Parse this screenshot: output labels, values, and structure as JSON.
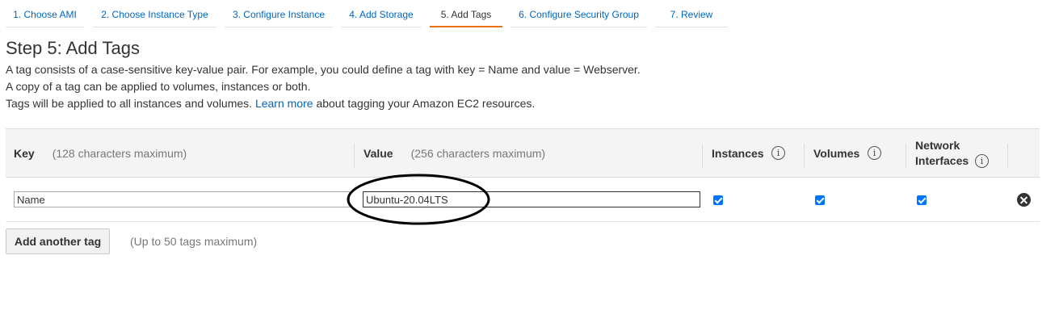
{
  "wizard": {
    "steps": [
      {
        "label": "1. Choose AMI"
      },
      {
        "label": "2. Choose Instance Type"
      },
      {
        "label": "3. Configure Instance"
      },
      {
        "label": "4. Add Storage"
      },
      {
        "label": "5. Add Tags"
      },
      {
        "label": "6. Configure Security Group"
      },
      {
        "label": "7. Review"
      }
    ],
    "active_step": "5. Add Tags"
  },
  "page": {
    "title": "Step 5: Add Tags",
    "description_1": "A tag consists of a case-sensitive key-value pair. For example, you could define a tag with key = Name and value = Webserver.",
    "description_2": "A copy of a tag can be applied to volumes, instances or both.",
    "description_3_pre": "Tags will be applied to all instances and volumes.",
    "learn_more_link": "Learn more",
    "description_3_post": "about tagging your Amazon EC2 resources."
  },
  "table": {
    "headers": {
      "key": "Key",
      "key_hint": "(128 characters maximum)",
      "value": "Value",
      "value_hint": "(256 characters maximum)",
      "instances": "Instances",
      "volumes": "Volumes",
      "network_interfaces_line1": "Network",
      "network_interfaces_line2": "Interfaces",
      "info_glyph": "i"
    },
    "rows": [
      {
        "key": "Name",
        "value": "Ubuntu-20.04LTS",
        "instances": true,
        "volumes": true,
        "network_interfaces": true
      }
    ]
  },
  "actions": {
    "add_tag_label": "Add another tag",
    "limit_hint": "(Up to 50 tags maximum)"
  },
  "colors": {
    "link": "#0066c0",
    "active_tab_underline": "#ec7211",
    "checkbox": "#0075ff",
    "header_bg": "#f4f4f4"
  },
  "icons": [
    "info-icon",
    "checkbox-checked-icon",
    "remove-circle-icon"
  ]
}
